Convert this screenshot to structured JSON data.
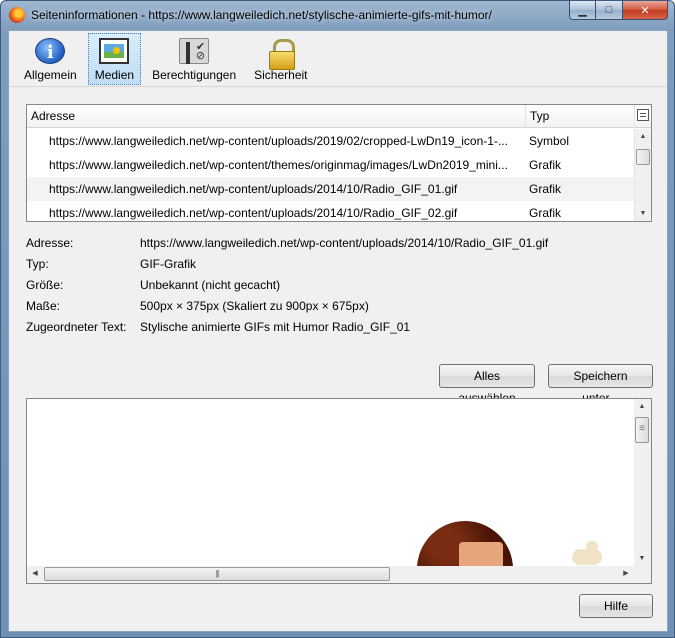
{
  "window": {
    "title": "Seiteninformationen - https://www.langweiledich.net/stylische-animierte-gifs-mit-humor/"
  },
  "toolbar": {
    "tabs": [
      {
        "label": "Allgemein",
        "icon": "info-icon",
        "active": false
      },
      {
        "label": "Medien",
        "icon": "media-icon",
        "active": true
      },
      {
        "label": "Berechtigungen",
        "icon": "permissions-icon",
        "active": false
      },
      {
        "label": "Sicherheit",
        "icon": "lock-icon",
        "active": false
      }
    ]
  },
  "media_list": {
    "columns": [
      "Adresse",
      "Typ"
    ],
    "rows": [
      {
        "address": "https://www.langweiledich.net/wp-content/uploads/2019/02/cropped-LwDn19_icon-1-...",
        "type": "Symbol"
      },
      {
        "address": "https://www.langweiledich.net/wp-content/themes/originmag/images/LwDn2019_mini...",
        "type": "Grafik"
      },
      {
        "address": "https://www.langweiledich.net/wp-content/uploads/2014/10/Radio_GIF_01.gif",
        "type": "Grafik"
      },
      {
        "address": "https://www.langweiledich.net/wp-content/uploads/2014/10/Radio_GIF_02.gif",
        "type": "Grafik"
      }
    ]
  },
  "details": [
    {
      "label": "Adresse:",
      "value": "https://www.langweiledich.net/wp-content/uploads/2014/10/Radio_GIF_01.gif"
    },
    {
      "label": "Typ:",
      "value": "GIF-Grafik"
    },
    {
      "label": "Größe:",
      "value": "Unbekannt (nicht gecacht)"
    },
    {
      "label": "Maße:",
      "value": "500px × 375px (Skaliert zu 900px × 675px)"
    },
    {
      "label": "Zugeordneter Text:",
      "value": "Stylische animierte GIFs mit Humor Radio_GIF_01"
    }
  ],
  "buttons": {
    "select_all": "Alles auswählen",
    "save_as": "Speichern unter...",
    "help": "Hilfe"
  }
}
